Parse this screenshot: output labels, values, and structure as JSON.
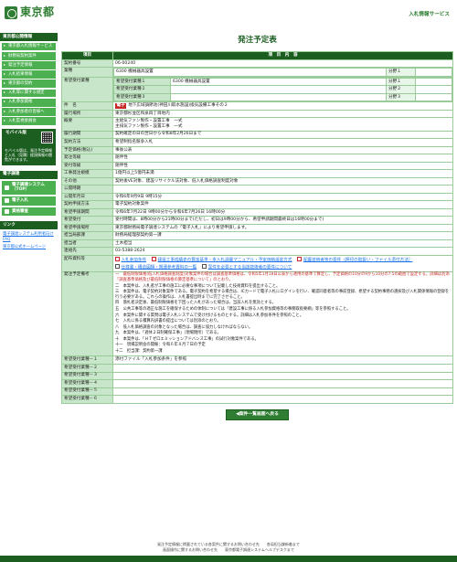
{
  "header": {
    "logo_text": "東京都",
    "title": "入札情報サービス"
  },
  "sidebar": {
    "section1": "東京都公開情報",
    "items": [
      "東京都入札情報サービス",
      "財務局契約案件",
      "発注予定情報",
      "入札結果情報",
      "東京都の契約",
      "入札等に関する規定",
      "入札参加資格",
      "入札参加者の皆様へ",
      "入札監視委員会"
    ],
    "mobile_title": "モバイル版",
    "mobile_text": "モバイル版は、発注予定情報と入札（見積）経過情報の閲覧ができます。",
    "section2": "電子調達",
    "buttons": [
      "電子調達システム（TOP）",
      "電子入札",
      "資格審査"
    ],
    "section3": "リンク",
    "links": [
      "電子調達システム利用者向けFAQ",
      "東京都公式ホームページ"
    ]
  },
  "main": {
    "page_title": "発注予定表",
    "col_item": "項目",
    "col_content": "項　目　内　容",
    "rows": {
      "contract_no": {
        "label": "契約番号",
        "value": "06-00240"
      },
      "category": {
        "label": "業種",
        "value": "6300 機械器具設置"
      },
      "desired_category_label": "希望受付業種",
      "desired": [
        {
          "sub": "希望受付業種１",
          "value": "6300 機械器具設置",
          "sep": "分野１",
          "sepval": ""
        },
        {
          "sub": "希望受付業種２",
          "value": "",
          "sep": "分野２",
          "sepval": ""
        },
        {
          "sub": "希望受付業種３",
          "value": "",
          "sep": "分野３",
          "sepval": ""
        }
      ],
      "name": {
        "label": "件　名",
        "tag": "電子",
        "value": "地下広域調節池(神田川取水施設)換気設備工事その２"
      },
      "location": {
        "label": "履行場所",
        "value": "東京都杉並区和泉四丁目地内"
      },
      "summary": {
        "label": "概要",
        "lines": [
          "主給気ファン製作・設置工事　一式",
          "主排気ファン製作・設置工事　一式"
        ]
      },
      "period": {
        "label": "履行期間",
        "value": "契約確定の日の翌日から令和8年2月26日まで"
      },
      "method": {
        "label": "契約方法",
        "value": "希望制指名競争入札"
      },
      "price": {
        "label": "予定価格(税込)",
        "value": "事後公表"
      },
      "publish": {
        "label": "発注等級",
        "value": "随伴性"
      },
      "receive": {
        "label": "受付等級",
        "value": "随伴性"
      },
      "scale": {
        "label": "工事発注規模",
        "value": "1億円以上5億円未満"
      },
      "other": {
        "label": "その他",
        "value": "契約後VE対象、建設リサイクル法対象、低入札価格調査制度対象"
      },
      "opening": {
        "label": "公開時期",
        "value": ""
      },
      "date_pub": {
        "label": "公開年月日",
        "value": "令和6年9月9日 9時15分"
      },
      "app_method": {
        "label": "契約申請方法",
        "value": "電子契約対象案件"
      },
      "app_period": {
        "label": "希望申請期間",
        "value": "令和6年7月22日 9時00分から令和6年7月26日 16時00分"
      },
      "app_time": {
        "label": "希望受付",
        "value": "受付時間は、8時00分から21時00分まで(ただし、初日は9時00分から、希望申請期間最終日は16時00分まで)"
      },
      "app_place": {
        "label": "希望申請場所",
        "value": "東京都財務局電子調達システムの「電子入札」により希望申請します。"
      },
      "dept": {
        "label": "担当局部課",
        "value": "財務局経理部契約第一課"
      },
      "person": {
        "label": "担当者",
        "value": "土木担当"
      },
      "tel": {
        "label": "連絡先",
        "value": "03-5388-2624"
      },
      "docs_label": "配布資料等",
      "docs": [
        "入札参加条件",
        "建設工事成績表の算定基準・本入札調書マニュアル・予定価格設定方式",
        "配置技術者等の要件（押印の取扱い・ファイル添付方法）",
        "仕様書・構造図類・関連参考資料の一覧",
        "案件を必要とする当該技術者の要件について"
      ],
      "notice_label": "発注予定備考",
      "notice": [
        "一　最低制限価格(低入札価格調査制度)対象案件の場合は調査基準価格は、令和5年1月18日公表から適用の基準で算定し、予定価格の10分の9から10分の7.5の範囲で設定する。詳細は別添「調査基準価格及び最低制限価格の算定基準について」のとおり。",
        "二　本案件は、入札者が工事の施工に必要な事項について記載した技術資料を提出すること。",
        "三　本案件は、電子契約対象案件である。電子契約を希望する場合は、ICカードで電子入札にログインを行い、確認同意者等の事前登録、希望する契約事務の選択及び入札関係情報の登録を行う必要がある。これらの操作は、入札書提出時までに完了させること。",
        "四　落札者決定後、最低制限価格を下回った入札があった場合は、当該入札を無効とする。",
        "五　公共工事等の適正な施工を確保するための体制については「建設工事に係る入札参加資格等の事務取扱要綱」等を参照すること。",
        "六　本案件に関する質問は電子入札システムで受け付けるものとする。詳細は入札参加条件を参照のこと。",
        "七　入札に係る積算内訳書の提出については別添のとおり。",
        "八　低入札価格調査の対象となった場合は、調査に協力しなければならない。",
        "九　本案件は、「週休２日制確保工事」（現場閉所）である。",
        "十　本案件は、「ＨＴゼロエミッションアドバンス工事」の試行対象案件である。",
        "十一　現場説明会の開催：令和６年８月７日の予定",
        "十二　担当課：契約第一課"
      ],
      "remarks": [
        {
          "label": "希望受付業種－１",
          "value": "添付ファイル「入札参加条件」を参照"
        },
        {
          "label": "希望受付業種－２",
          "value": ""
        },
        {
          "label": "希望受付業種－３",
          "value": ""
        },
        {
          "label": "希望受付業種－４",
          "value": ""
        },
        {
          "label": "希望受付業種－５",
          "value": ""
        },
        {
          "label": "希望受付業種－６",
          "value": ""
        }
      ]
    },
    "back_button": "◀案件一覧画面へ戻る"
  },
  "footer": {
    "line1": "発注予定情報に掲載されている各案件に関するお問い合わせ先　　各局担当課新着まで",
    "line2": "画面操作に関するお問い合わせ先　　東京都電子調達システムヘルプデスクまで"
  }
}
